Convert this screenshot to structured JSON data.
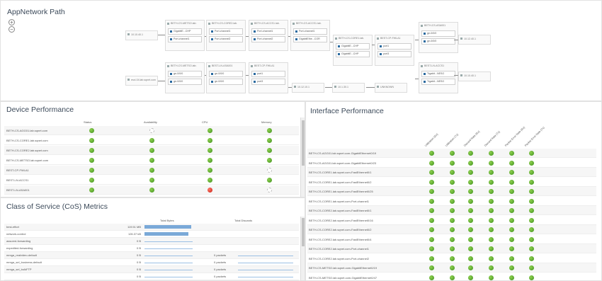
{
  "path": {
    "title": "AppNetwork Path",
    "zoom_in": "+",
    "zoom_out": "−",
    "nodes": [
      {
        "name": "BETH-CS-METSO.lab.",
        "ports": [
          "GigabitE...CHP",
          "Port-channel1"
        ]
      },
      {
        "name": "BETH-CS-CORE2.lab.",
        "ports": [
          "Port-channel1",
          "Port-channel2"
        ]
      },
      {
        "name": "BETH-CS-ACCS1.lab.",
        "ports": [
          "Port-channel1",
          "Port-channel2"
        ]
      },
      {
        "name": "BETH-CS-ACCS1.lab.",
        "ports": [
          "Port-channel1",
          "GigabitEthe...COR"
        ]
      },
      {
        "name": "BETH-CS-CORE1.lab.",
        "ports": [
          "GigabitE...CHP",
          "GigabitE...CHP"
        ]
      },
      {
        "name": "BEST-CP-FWLA1",
        "ports": [
          "port1",
          "port3"
        ]
      },
      {
        "name": "BETH-CS-ASA001",
        "ports": [
          "ge-0/0/0",
          "ge-0/0/0"
        ]
      },
      {
        "name": "BETH-CS-METSO.lab.",
        "ports": [
          "ge-0/0/0",
          "ge-0/0/0"
        ]
      },
      {
        "name": "BEST-LN-ASA001",
        "ports": [
          "ge-0/0/0",
          "ge-0/0/0"
        ]
      },
      {
        "name": "BEST-CP-FWLA1",
        "ports": [
          "port1",
          "port3"
        ]
      },
      {
        "name": "BEST-LN-ACCS1",
        "ports": [
          "Trgabit...NESO",
          "Trgabit...NESO"
        ]
      },
      {
        "name": "BETH-CS-METSO.lab.",
        "ports": [
          "GigabitE...CHP",
          "Loopback100"
        ]
      }
    ],
    "endpoints": [
      "10.10.40.1",
      "esxi-04.lab.sqnet.com",
      "10.12.40.1",
      "10.12.10.1",
      "10.1.30.1",
      "UNKNOWN",
      "10.10.40.1"
    ],
    "endpoint_sub": "eth1/sub",
    "endpoint_sub2": "vlan0"
  },
  "device": {
    "title": "Device Performance",
    "columns": [
      "Status",
      "Availability",
      "CPU",
      "Memory"
    ],
    "rows": [
      {
        "name": "BETH-CS-AGG01.lab.sqnet.com",
        "s": "g",
        "a": "ring",
        "c": "g",
        "m": "g"
      },
      {
        "name": "BETH-CS-CORE1.lab.sqnet.com",
        "s": "g",
        "a": "g",
        "c": "g",
        "m": "g"
      },
      {
        "name": "BETH-CS-CORE2.lab.sqnet.com",
        "s": "g",
        "a": "g",
        "c": "g",
        "m": "g"
      },
      {
        "name": "BETH-CS-METSO.lab.sqnet.com",
        "s": "g",
        "a": "g",
        "c": "g",
        "m": "g"
      },
      {
        "name": "BEST-CP-FWLA1",
        "s": "g",
        "a": "g",
        "c": "g",
        "m": "ring"
      },
      {
        "name": "BEST-LN-ACCS1",
        "s": "g",
        "a": "g",
        "c": "g",
        "m": "g"
      },
      {
        "name": "BEST-LN-ASA001",
        "s": "g",
        "a": "g",
        "c": "r",
        "m": "ring"
      }
    ]
  },
  "cos": {
    "title": "Class of Service (CoS) Metrics",
    "columns": [
      "Total Bytes",
      "Total Discards"
    ],
    "rows": [
      {
        "name": "best-effort",
        "bytes": "119.51 MB",
        "bar": 0.92,
        "disc": ""
      },
      {
        "name": "network-control",
        "bytes": "126.37 kB",
        "bar": 0.86,
        "disc": ""
      },
      {
        "name": "assured-forwarding",
        "bytes": "0 B",
        "bar": 0,
        "disc": ""
      },
      {
        "name": "expedited-forwarding",
        "bytes": "0 B",
        "bar": 0,
        "disc": ""
      },
      {
        "name": "mmga_realvideo-default",
        "bytes": "0 B",
        "bar": 0,
        "disc": "0 packets"
      },
      {
        "name": "mmga_sel_business-default",
        "bytes": "0 B",
        "bar": 0,
        "disc": "0 packets"
      },
      {
        "name": "mmga_sel_bulkFTP",
        "bytes": "0 B",
        "bar": 0,
        "disc": "0 packets"
      },
      {
        "name": "",
        "bytes": "0 B",
        "bar": 0,
        "disc": "0 packets"
      }
    ]
  },
  "iface": {
    "title": "Interface Performance",
    "columns": [
      "Utilization (Rx)",
      "Utilization (Tx)",
      "Discard Rate (Rx)",
      "Discard Rate (Tx)",
      "Packet Error Rate (Rx)",
      "Packet Error Rate (Tx)"
    ],
    "rows": [
      "BETH-CS-AGG01.lab.sqnet.com-GigabitEthernet0/19",
      "BETH-CS-AGG01.lab.sqnet.com-GigabitEthernet0/23",
      "BETH-CS-CORE1.lab.sqnet.com-FastEthernet0/1",
      "BETH-CS-CORE1.lab.sqnet.com-FastEthernet0/2",
      "BETH-CS-CORE1.lab.sqnet.com-FastEthernet0/25",
      "BETH-CS-CORE1.lab.sqnet.com-Port-channel1",
      "BETH-CS-CORE2.lab.sqnet.com-FastEthernet0/1",
      "BETH-CS-CORE2.lab.sqnet.com-FastEthernet0/16",
      "BETH-CS-CORE2.lab.sqnet.com-FastEthernet0/2",
      "BETH-CS-CORE2.lab.sqnet.com-FastEthernet0/4",
      "BETH-CS-CORE2.lab.sqnet.com-Port-channel1",
      "BETH-CS-CORE2.lab.sqnet.com-Port-channel2",
      "BETH-CS-METSO.lab.sqnet.com-GigabitEthernet0/19",
      "BETH-CS-METSO.lab.sqnet.com-GigabitEthernet0/47"
    ]
  }
}
